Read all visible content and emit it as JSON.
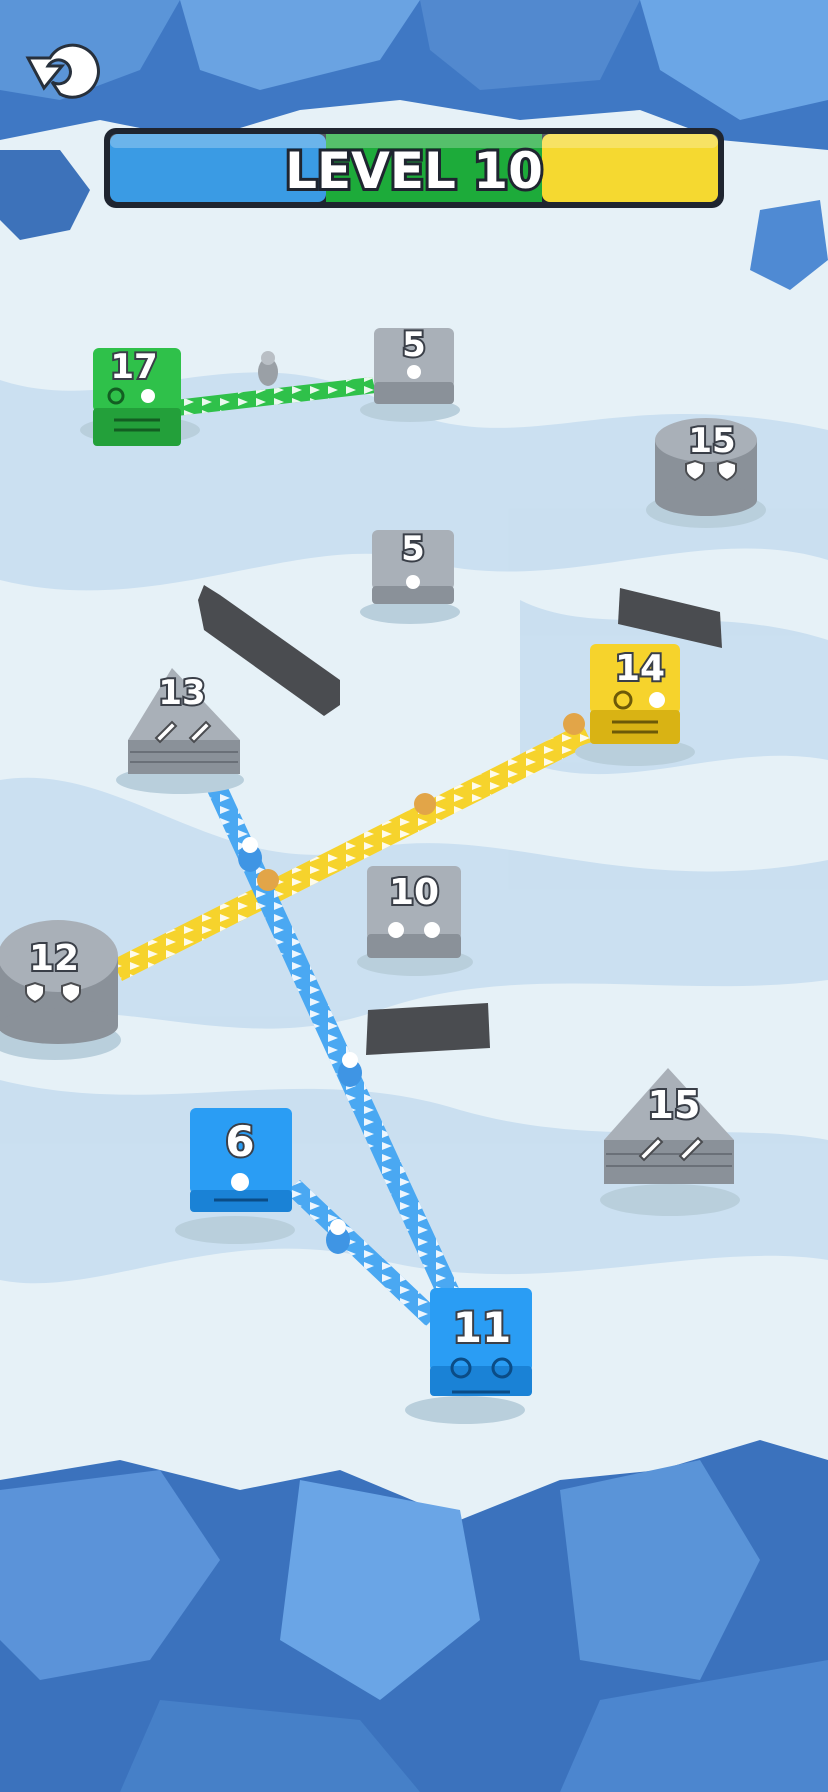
{
  "hud": {
    "level_label": "LEVEL 10",
    "restart_icon": "restart-arrow-icon",
    "progress_colors": [
      "#3a9be4",
      "#1dab3a",
      "#f5d930"
    ]
  },
  "colors": {
    "blue_team": "#2a9df4",
    "green_team": "#2fc14a",
    "yellow_team": "#f6d32c",
    "neutral": "#a9b0b8",
    "obstacle": "#4a4c50"
  },
  "buildings": [
    {
      "id": "green-17",
      "team": "green",
      "kind": "box",
      "label": "17",
      "icon": "two-dots"
    },
    {
      "id": "neutral-5-top",
      "team": "neutral",
      "kind": "box",
      "label": "5",
      "icon": "one-dot"
    },
    {
      "id": "neutral-15-cyl",
      "team": "neutral",
      "kind": "cylinder",
      "label": "15",
      "icon": "shield-icon"
    },
    {
      "id": "neutral-5-mid",
      "team": "neutral",
      "kind": "box",
      "label": "5",
      "icon": "one-dot"
    },
    {
      "id": "yellow-14",
      "team": "yellow",
      "kind": "box",
      "label": "14",
      "icon": "two-dots"
    },
    {
      "id": "neutral-13-tri",
      "team": "neutral",
      "kind": "triangle",
      "label": "13",
      "icon": "sword-icon"
    },
    {
      "id": "neutral-10",
      "team": "neutral",
      "kind": "box",
      "label": "10",
      "icon": "two-dots"
    },
    {
      "id": "neutral-12-cyl",
      "team": "neutral",
      "kind": "cylinder",
      "label": "12",
      "icon": "shield-icon"
    },
    {
      "id": "neutral-15-tri",
      "team": "neutral",
      "kind": "triangle",
      "label": "15",
      "icon": "sword-icon"
    },
    {
      "id": "blue-6",
      "team": "blue",
      "kind": "box",
      "label": "6",
      "icon": "one-dot"
    },
    {
      "id": "blue-11",
      "team": "blue",
      "kind": "box",
      "label": "11",
      "icon": "two-dots"
    }
  ],
  "paths": [
    {
      "from": "green-17",
      "to": "neutral-5-top",
      "team": "green"
    },
    {
      "from": "yellow-14",
      "to": "neutral-12-cyl",
      "team": "yellow"
    },
    {
      "from": "neutral-13-tri",
      "to": "blue-11",
      "team": "blue"
    },
    {
      "from": "blue-6",
      "to": "blue-11",
      "team": "blue"
    }
  ]
}
